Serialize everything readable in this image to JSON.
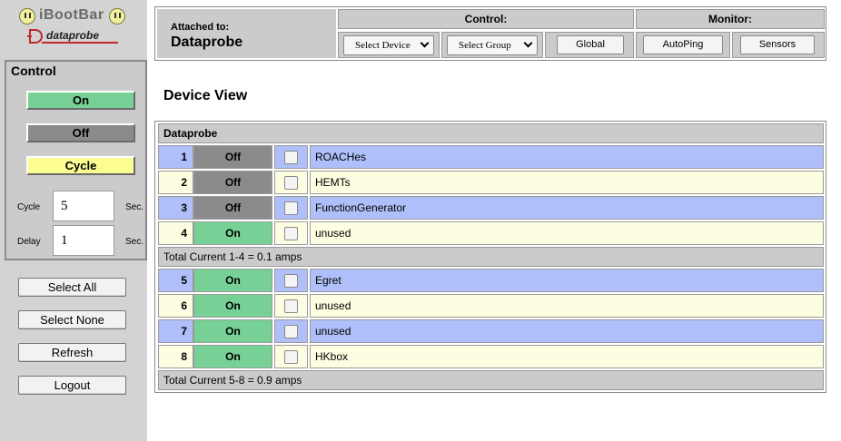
{
  "logo": {
    "product": "iBootBar",
    "brand": "dataprobe"
  },
  "control": {
    "title": "Control",
    "on_label": "On",
    "off_label": "Off",
    "cycle_label": "Cycle",
    "cycle_field_label": "Cycle",
    "cycle_value": "5",
    "delay_field_label": "Delay",
    "delay_value": "1",
    "unit": "Sec."
  },
  "sidebar_buttons": {
    "select_all": "Select All",
    "select_none": "Select None",
    "refresh": "Refresh",
    "logout": "Logout"
  },
  "header": {
    "attached_label": "Attached to:",
    "attached_value": "Dataprobe",
    "control_title": "Control:",
    "monitor_title": "Monitor:",
    "select_device": "Select Device",
    "select_group": "Select Group",
    "global": "Global",
    "autoping": "AutoPing",
    "sensors": "Sensors"
  },
  "device_view": {
    "title": "Device View",
    "group_name": "Dataprobe",
    "total_1": "Total Current 1-4 = 0.1 amps",
    "total_2": "Total Current 5-8 = 0.9 amps",
    "outlets": [
      {
        "num": "1",
        "state": "Off",
        "name": "ROACHes"
      },
      {
        "num": "2",
        "state": "Off",
        "name": "HEMTs"
      },
      {
        "num": "3",
        "state": "Off",
        "name": "FunctionGenerator"
      },
      {
        "num": "4",
        "state": "On",
        "name": "unused"
      },
      {
        "num": "5",
        "state": "On",
        "name": "Egret"
      },
      {
        "num": "6",
        "state": "On",
        "name": "unused"
      },
      {
        "num": "7",
        "state": "On",
        "name": "unused"
      },
      {
        "num": "8",
        "state": "On",
        "name": "HKbox"
      }
    ]
  },
  "colors": {
    "on": "#77d196",
    "off": "#8b8b8b",
    "cycle": "#fbfd93",
    "row_blue": "#aebff9",
    "row_cream": "#fdfde1",
    "panel_gray": "#cbcbcb"
  }
}
